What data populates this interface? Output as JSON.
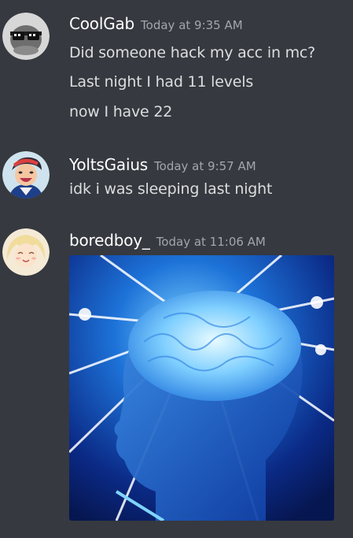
{
  "messages": [
    {
      "username": "CoolGab",
      "timestamp": "Today at 9:35 AM",
      "avatar_icon": "sunglasses-avatar-icon",
      "lines": [
        "Did someone hack my acc in mc?",
        "Last night I had 11 levels",
        "now I have 22"
      ]
    },
    {
      "username": "YoltsGaius",
      "timestamp": "Today at 9:57 AM",
      "avatar_icon": "anime-boy-avatar-icon",
      "lines": [
        "idk i was sleeping last night"
      ]
    },
    {
      "username": "boredboy_",
      "timestamp": "Today at 11:06 AM",
      "avatar_icon": "anime-blonde-avatar-icon",
      "lines": [],
      "attachment": "galaxy-brain-meme-image"
    }
  ],
  "colors": {
    "background": "#36393f",
    "username": "#ffffff",
    "timestamp": "#a3a6aa",
    "text": "#dcddde"
  }
}
